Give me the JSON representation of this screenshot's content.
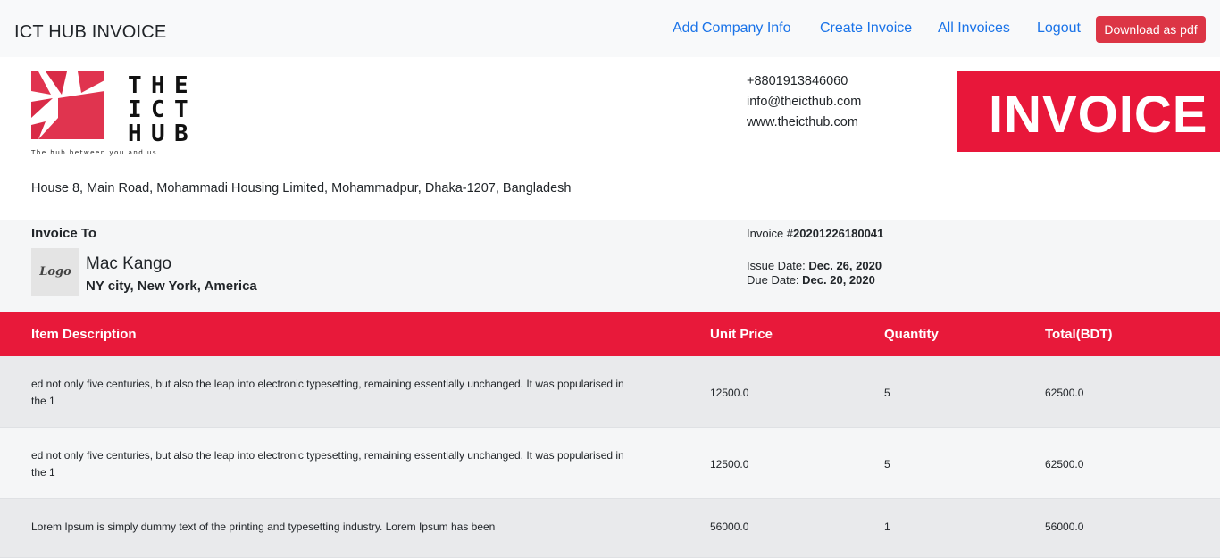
{
  "navbar": {
    "brand": "ICT HUB INVOICE",
    "links": [
      "Add Company Info",
      "Create Invoice",
      "All Invoices",
      "Logout"
    ],
    "download_label": "Download as pdf"
  },
  "company": {
    "logo_letters": [
      "T",
      "H",
      "E",
      "I",
      "C",
      "T",
      "H",
      "U",
      "B"
    ],
    "tagline": "The hub between you and us",
    "phone": "+8801913846060",
    "email": "info@theicthub.com",
    "website": "www.theicthub.com",
    "address": "House 8, Main Road, Mohammadi Housing Limited, Mohammadpur, Dhaka-1207, Bangladesh"
  },
  "banner": {
    "label": "INVOICE"
  },
  "bill_to": {
    "label": "Invoice To",
    "logo_text": "Logo",
    "name": "Mac Kango",
    "address": "NY city, New York, America"
  },
  "invoice_meta": {
    "number_label": "Invoice #",
    "number": "20201226180041",
    "issue_label": "Issue Date: ",
    "issue_date": "Dec. 26, 2020",
    "due_label": "Due Date: ",
    "due_date": "Dec. 20, 2020"
  },
  "table": {
    "headers": [
      "Item Description",
      "Unit Price",
      "Quantity",
      "Total(BDT)"
    ],
    "rows": [
      {
        "line1": "ed not only five centuries, but also the leap into electronic typesetting, remaining essentially unchanged. It was popularised in",
        "line2": "the 1",
        "unit_price": "12500.0",
        "quantity": "5",
        "total": "62500.0"
      },
      {
        "line1": "ed not only five centuries, but also the leap into electronic typesetting, remaining essentially unchanged. It was popularised in",
        "line2": "the 1",
        "unit_price": "12500.0",
        "quantity": "5",
        "total": "62500.0"
      },
      {
        "line1": "Lorem Ipsum is simply dummy text of the printing and typesetting industry. Lorem Ipsum has been",
        "line2": "",
        "unit_price": "56000.0",
        "quantity": "1",
        "total": "56000.0"
      }
    ]
  },
  "colors": {
    "accent_red": "#e8193a",
    "link_blue": "#1a73e8",
    "button_red": "#dc3545"
  }
}
